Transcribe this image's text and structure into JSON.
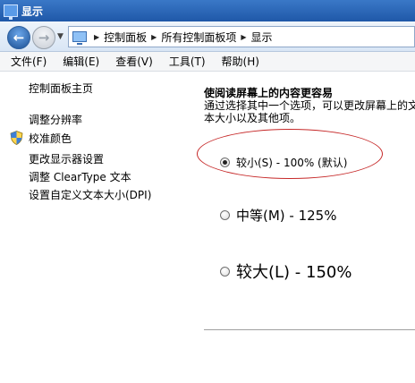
{
  "window": {
    "title": "显示"
  },
  "address": {
    "breadcrumbs": [
      "控制面板",
      "所有控制面板项",
      "显示"
    ]
  },
  "menu": [
    "文件(F)",
    "编辑(E)",
    "查看(V)",
    "工具(T)",
    "帮助(H)"
  ],
  "sidebar": {
    "items": [
      {
        "label": "控制面板主页"
      },
      {
        "label": "调整分辨率"
      },
      {
        "label": "校准颜色",
        "icon": "shield-icon"
      },
      {
        "label": "更改显示器设置"
      },
      {
        "label": "调整 ClearType 文本"
      },
      {
        "label": "设置自定义文本大小(DPI)"
      }
    ]
  },
  "main": {
    "heading": "使阅读屏幕上的内容更容易",
    "description": "通过选择其中一个选项，可以更改屏幕上的文本大小以及其他项。",
    "options": [
      {
        "label": "较小(S) - 100% (默认)",
        "checked": true
      },
      {
        "label": "中等(M) - 125%",
        "checked": false
      },
      {
        "label": "较大(L) - 150%",
        "checked": false
      }
    ]
  },
  "colors": {
    "titlebar": "#2a63b3",
    "highlight": "#c62828"
  }
}
